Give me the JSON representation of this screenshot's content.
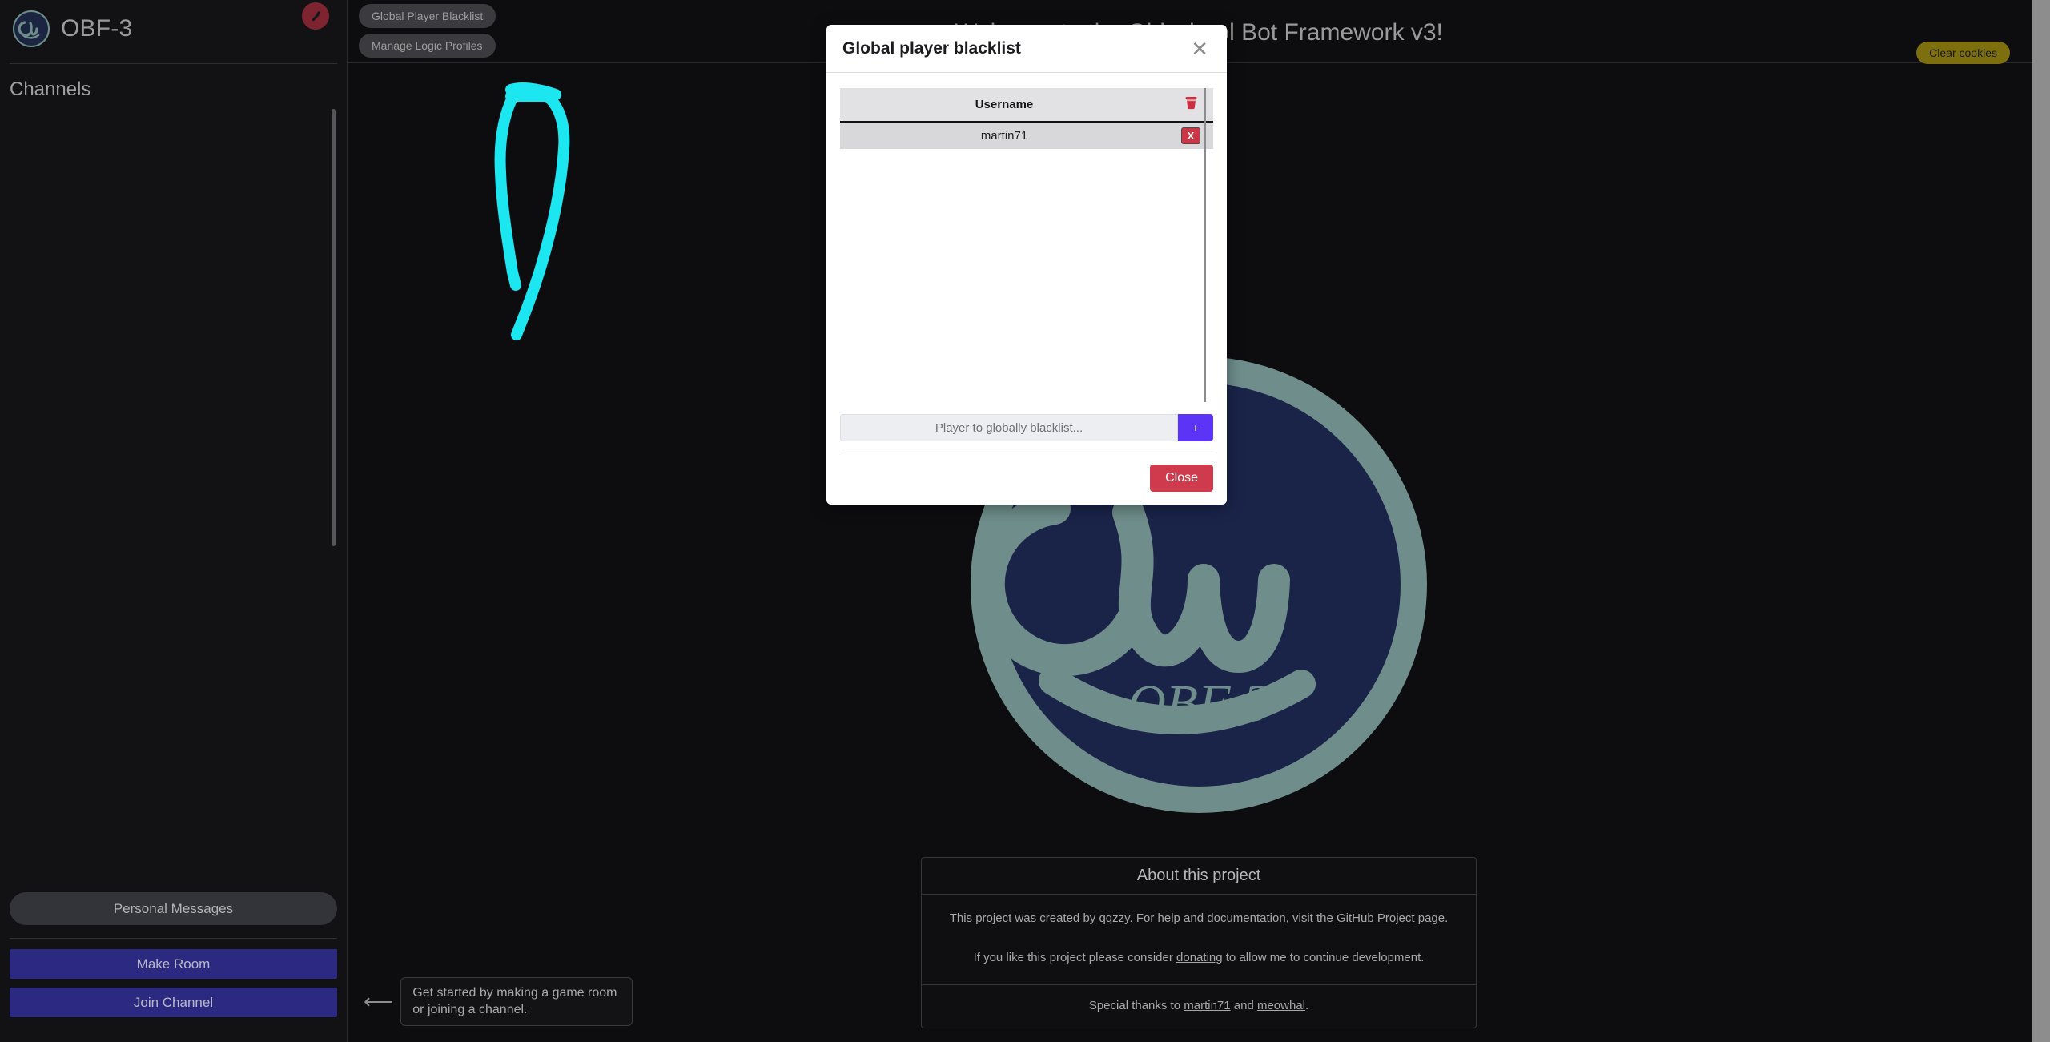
{
  "sidebar": {
    "app_title": "OBF-3",
    "logo_icon": "obf-circle-logo-icon",
    "plug_button_icon": "plug-disconnect-icon",
    "section_title": "Channels",
    "personal_messages_label": "Personal Messages",
    "make_room_label": "Make Room",
    "join_channel_label": "Join Channel"
  },
  "topbar": {
    "global_player_blacklist_label": "Global Player Blacklist",
    "manage_logic_profiles_label": "Manage Logic Profiles",
    "page_title": "Welcome to the Oldschool Bot Framework v3!",
    "clear_cookies_label": "Clear cookies"
  },
  "watermark": {
    "brand_text": "OBF 3",
    "ring_color": "#6f8e8b",
    "fill_color": "#1a2449"
  },
  "about": {
    "heading": "About this project",
    "line1_part1": "This project was created by ",
    "line1_link1": "qqzzy",
    "line1_part2": ". For help and documentation, visit the ",
    "line1_link2": "GitHub Project",
    "line1_part3": " page.",
    "line2_part1": "If you like this project please consider ",
    "line2_link1": "donating",
    "line2_part2": " to allow me to continue development.",
    "thanks_part1": "Special thanks to ",
    "thanks_link1": "martin71",
    "thanks_part2": " and ",
    "thanks_link2": "meowhal",
    "thanks_part3": "."
  },
  "callout": {
    "arrow_icon": "left-arrow-icon",
    "text": "Get started by making a game room or joining a channel."
  },
  "modal": {
    "title": "Global player blacklist",
    "close_icon": "close-x-icon",
    "table": {
      "columns": [
        "Username",
        ""
      ],
      "header_action_icon": "trash-can-icon",
      "rows": [
        {
          "username": "martin71",
          "action_label": "X"
        }
      ]
    },
    "input_placeholder": "Player to globally blacklist...",
    "input_value": "",
    "add_button_label": "+",
    "close_button_label": "Close"
  },
  "annotation": {
    "arrow_color": "#1ce6f0",
    "points_to": "Global Player Blacklist"
  },
  "colors": {
    "accent_purple": "#5b34f5",
    "danger_red": "#cf3b4d",
    "cookie_olive": "#7d6f0d",
    "primary_blue": "#2b2a80"
  }
}
